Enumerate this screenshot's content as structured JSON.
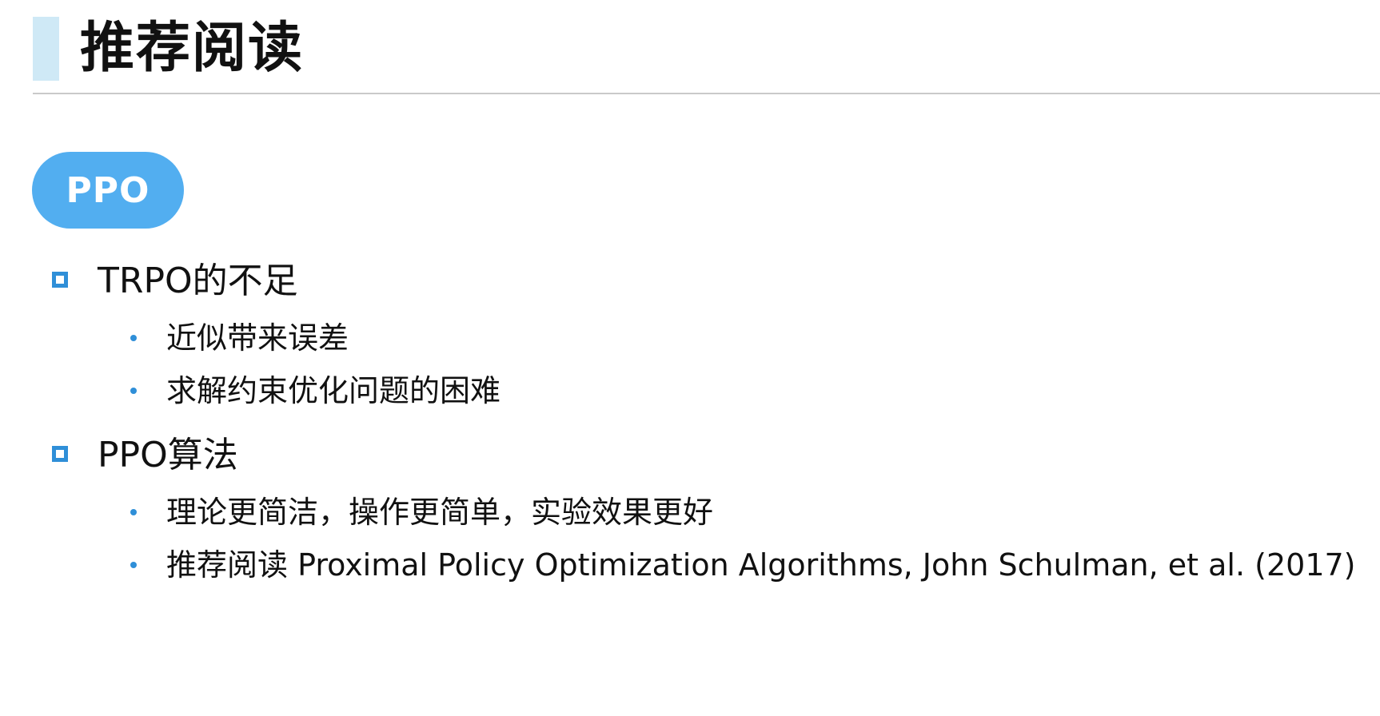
{
  "title": "推荐阅读",
  "badge": "PPO",
  "sections": [
    {
      "label": "TRPO的不足",
      "items": [
        "近似带来误差",
        "求解约束优化问题的困难"
      ]
    },
    {
      "label": "PPO算法",
      "items": [
        "理论更简洁，操作更简单，实验效果更好",
        "推荐阅读 Proximal Policy Optimization Algorithms, John Schulman, et al. (2017)"
      ]
    }
  ],
  "colors": {
    "accent": "#52aef0",
    "bullet": "#2f8fd8",
    "title_bar": "#cfe9f6",
    "rule": "#c9c9c9"
  },
  "icons": {
    "section_bullet": "hollow-square-bullet-icon",
    "item_bullet": "dot-bullet-icon"
  }
}
